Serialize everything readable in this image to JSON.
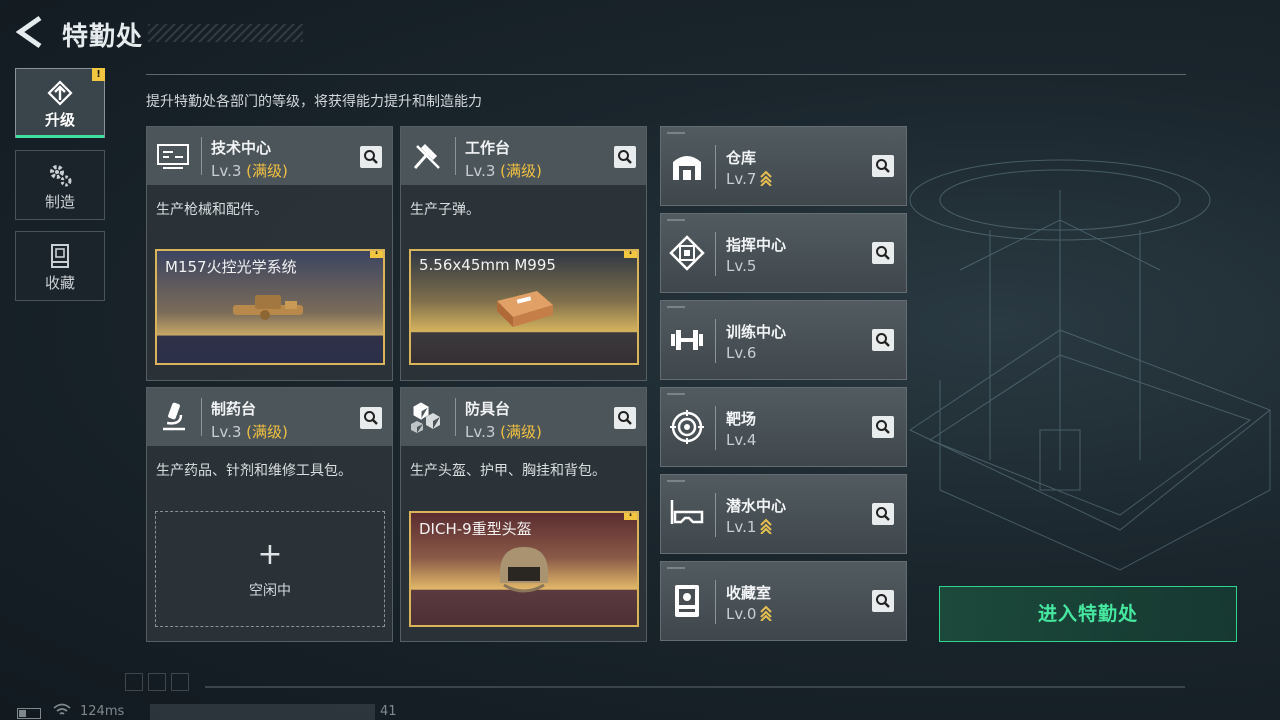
{
  "header": {
    "title": "特勤处"
  },
  "tabs": [
    {
      "label": "升级",
      "icon": "upgrade-icon",
      "active": true,
      "warning": "!"
    },
    {
      "label": "制造",
      "icon": "gear-icon",
      "active": false
    },
    {
      "label": "收藏",
      "icon": "collection-icon",
      "active": false
    }
  ],
  "description": "提升特勤处各部门的等级，将获得能力提升和制造能力",
  "cards": [
    {
      "name": "技术中心",
      "level": "Lv.3",
      "max": "(满级)",
      "produce": "生产枪械和配件。",
      "icon": "tech-center-icon",
      "slot": {
        "title": "M157火控光学系统",
        "warning": "!"
      }
    },
    {
      "name": "工作台",
      "level": "Lv.3",
      "max": "(满级)",
      "produce": "生产子弹。",
      "icon": "workbench-icon",
      "slot": {
        "title": "5.56x45mm M995",
        "warning": "!"
      }
    },
    {
      "name": "制药台",
      "level": "Lv.3",
      "max": "(满级)",
      "produce": "生产药品、针剂和维修工具包。",
      "icon": "pharmacy-icon",
      "slot": {
        "empty_text": "空闲中",
        "plus": "+"
      }
    },
    {
      "name": "防具台",
      "level": "Lv.3",
      "max": "(满级)",
      "produce": "生产头盔、护甲、胸挂和背包。",
      "icon": "armor-bench-icon",
      "slot": {
        "title": "DICH-9重型头盔",
        "warning": "!"
      }
    }
  ],
  "facilities": [
    {
      "name": "仓库",
      "level": "Lv.7",
      "upgradable": true,
      "icon": "warehouse-icon"
    },
    {
      "name": "指挥中心",
      "level": "Lv.5",
      "upgradable": false,
      "icon": "command-center-icon"
    },
    {
      "name": "训练中心",
      "level": "Lv.6",
      "upgradable": false,
      "icon": "dumbbell-icon"
    },
    {
      "name": "靶场",
      "level": "Lv.4",
      "upgradable": false,
      "icon": "target-icon"
    },
    {
      "name": "潜水中心",
      "level": "Lv.1",
      "upgradable": true,
      "icon": "diving-mask-icon"
    },
    {
      "name": "收藏室",
      "level": "Lv.0",
      "upgradable": true,
      "icon": "collection-room-icon"
    }
  ],
  "enter_button": "进入特勤处",
  "status_bar": {
    "ping": "124ms",
    "suffix": "41"
  },
  "colors": {
    "accent": "#46e8a0",
    "max_level": "#f1c040",
    "warning": "#f2c640"
  }
}
